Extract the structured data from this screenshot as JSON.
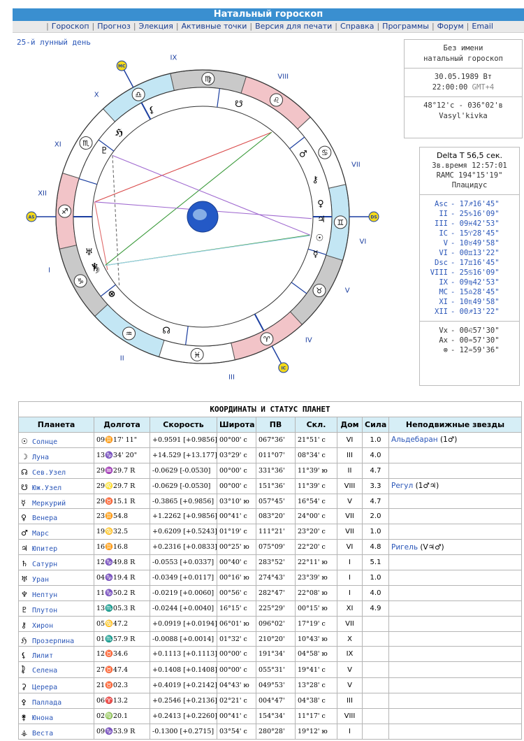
{
  "header": {
    "title": "Натальный гороскоп"
  },
  "menu": [
    "Гороскоп",
    "Прогноз",
    "Элекция",
    "Активные точки",
    "Версия для печати",
    "Справка",
    "Программы",
    "Форум",
    "Email"
  ],
  "lunar_day": "25-й лунный день",
  "info": {
    "name": "Без имени",
    "type": "натальный гороскоп",
    "date": "30.05.1989 Вт",
    "time": "22:00:00",
    "gmt": "GMT+4",
    "coords": "48°12'с - 036°02'в",
    "place": "Vasyl'kivka"
  },
  "params": {
    "delta_t": "Delta T   56,5 сек.",
    "sidereal": "Зв.время 12:57:01",
    "ramc": "RAMC 194°15'19\"",
    "system": "Плацидус",
    "houses": [
      {
        "k": "Asc",
        "v": "17♐16'45\""
      },
      {
        "k": "II",
        "v": "25♑16'09\""
      },
      {
        "k": "III",
        "v": "09♓42'53\""
      },
      {
        "k": "IC",
        "v": "15♈28'45\""
      },
      {
        "k": "V",
        "v": "10♉49'58\""
      },
      {
        "k": "VI",
        "v": "00♊13'22\""
      },
      {
        "k": "Dsc",
        "v": "17♊16'45\""
      },
      {
        "k": "VIII",
        "v": "25♋16'09\""
      },
      {
        "k": "IX",
        "v": "09♍42'53\""
      },
      {
        "k": "MC",
        "v": "15♎28'45\""
      },
      {
        "k": "XI",
        "v": "10♏49'58\""
      },
      {
        "k": "XII",
        "v": "00♐13'22\""
      }
    ],
    "points": [
      {
        "k": "Vx",
        "v": "00♌57'30\""
      },
      {
        "k": "Ax",
        "v": "00♒57'30\""
      },
      {
        "k": "⊗",
        "v": "12♒59'36\""
      }
    ]
  },
  "wheel": {
    "house_labels": [
      "I",
      "II",
      "III",
      "IV",
      "V",
      "VI",
      "VII",
      "VIII",
      "IX",
      "X",
      "XI",
      "XII"
    ],
    "angle_labels": {
      "as": "AS",
      "ds": "DS",
      "mc": "MC",
      "ic": "IC"
    },
    "signs": [
      "♈",
      "♉",
      "♊",
      "♋",
      "♌",
      "♍",
      "♎",
      "♏",
      "♐",
      "♑",
      "♒",
      "♓"
    ],
    "planet_glyphs": [
      "☉",
      "☽",
      "☊",
      "☋",
      "☿",
      "♀",
      "♂",
      "♃",
      "♄",
      "♅",
      "♆",
      "♇",
      "⚷",
      "ℌ",
      "⚸",
      "⯝",
      "⚳",
      "⚴",
      "⚵",
      "⚶",
      "⊗"
    ],
    "colors": {
      "fire": "#f2c4c8",
      "earth": "#c9c9c9",
      "air": "#c3e6f4",
      "water": "#ffffff",
      "accent": "#2a56b8",
      "mark": "#f3d91a"
    }
  },
  "table": {
    "caption": "КООРДИНАТЫ И СТАТУС ПЛАНЕТ",
    "headers": [
      "Планета",
      "Долгота",
      "Скорость",
      "Широта",
      "ПВ",
      "Скл.",
      "Дом",
      "Сила",
      "Неподвижные звезды"
    ],
    "rows": [
      {
        "sym": "☉",
        "name": "Солнце",
        "lon": "09♊17' 11\"",
        "spd": "+0.9591  [+0.9856]",
        "lat": "00°00' с",
        "pv": "067°36'",
        "dec": "21°51' с",
        "house": "VI",
        "power": "1.0",
        "star": "Альдебаран",
        "star_det": "(1♂)"
      },
      {
        "sym": "☽",
        "name": "Луна",
        "lon": "13♑34' 20\"",
        "spd": "+14.529  [+13.177]",
        "lat": "03°29' с",
        "pv": "011°07'",
        "dec": "08°34' с",
        "house": "III",
        "power": "4.0",
        "star": "",
        "star_det": ""
      },
      {
        "sym": "☊",
        "name": "Сев.Узел",
        "lon": "29♒29.7  R",
        "spd": "-0.0629  [-0.0530]",
        "lat": "00°00' с",
        "pv": "331°36'",
        "dec": "11°39' ю",
        "house": "II",
        "power": "4.7",
        "star": "",
        "star_det": ""
      },
      {
        "sym": "☋",
        "name": "Юж.Узел",
        "lon": "29♌29.7  R",
        "spd": "-0.0629  [-0.0530]",
        "lat": "00°00' с",
        "pv": "151°36'",
        "dec": "11°39' с",
        "house": "VIII",
        "power": "3.3",
        "star": "Регул",
        "star_det": "(1♂♃)"
      },
      {
        "sym": "☿",
        "name": "Меркурий",
        "lon": "29♉15.1  R",
        "spd": "-0.3865  [+0.9856]",
        "lat": "03°10' ю",
        "pv": "057°45'",
        "dec": "16°54' с",
        "house": "V",
        "power": "4.7",
        "star": "",
        "star_det": ""
      },
      {
        "sym": "♀",
        "name": "Венера",
        "lon": "23♊54.8",
        "spd": "+1.2262  [+0.9856]",
        "lat": "00°41' с",
        "pv": "083°20'",
        "dec": "24°00' с",
        "house": "VII",
        "power": "2.0",
        "star": "",
        "star_det": ""
      },
      {
        "sym": "♂",
        "name": "Марс",
        "lon": "19♋32.5",
        "spd": "+0.6209  [+0.5243]",
        "lat": "01°19' с",
        "pv": "111°21'",
        "dec": "23°20' с",
        "house": "VII",
        "power": "1.0",
        "star": "",
        "star_det": ""
      },
      {
        "sym": "♃",
        "name": "Юпитер",
        "lon": "16♊16.8",
        "spd": "+0.2316  [+0.0833]",
        "lat": "00°25' ю",
        "pv": "075°09'",
        "dec": "22°20' с",
        "house": "VI",
        "power": "4.8",
        "star": "Ригель",
        "star_det": "(V♃♂)"
      },
      {
        "sym": "♄",
        "name": "Сатурн",
        "lon": "12♑49.8  R",
        "spd": "-0.0553  [+0.0337]",
        "lat": "00°40' с",
        "pv": "283°52'",
        "dec": "22°11' ю",
        "house": "I",
        "power": "5.1",
        "star": "",
        "star_det": ""
      },
      {
        "sym": "♅",
        "name": "Уран",
        "lon": "04♑19.4  R",
        "spd": "-0.0349  [+0.0117]",
        "lat": "00°16' ю",
        "pv": "274°43'",
        "dec": "23°39' ю",
        "house": "I",
        "power": "1.0",
        "star": "",
        "star_det": ""
      },
      {
        "sym": "♆",
        "name": "Нептун",
        "lon": "11♑50.2  R",
        "spd": "-0.0219  [+0.0060]",
        "lat": "00°56' с",
        "pv": "282°47'",
        "dec": "22°08' ю",
        "house": "I",
        "power": "4.0",
        "star": "",
        "star_det": ""
      },
      {
        "sym": "♇",
        "name": "Плутон",
        "lon": "13♏05.3  R",
        "spd": "-0.0244  [+0.0040]",
        "lat": "16°15' с",
        "pv": "225°29'",
        "dec": "00°15' ю",
        "house": "XI",
        "power": "4.9",
        "star": "",
        "star_det": ""
      },
      {
        "sym": "⚷",
        "name": "Хирон",
        "lon": "05♋47.2",
        "spd": "+0.0919  [+0.0194]",
        "lat": "06°01' ю",
        "pv": "096°02'",
        "dec": "17°19' с",
        "house": "VII",
        "power": "",
        "star": "",
        "star_det": ""
      },
      {
        "sym": "ℌ",
        "name": "Прозерпина",
        "lon": "01♏57.9  R",
        "spd": "-0.0088  [+0.0014]",
        "lat": "01°32' с",
        "pv": "210°20'",
        "dec": "10°43' ю",
        "house": "X",
        "power": "",
        "star": "",
        "star_det": ""
      },
      {
        "sym": "⚸",
        "name": "Лилит",
        "lon": "12♉34.6",
        "spd": "+0.1113  [+0.1113]",
        "lat": "00°00' с",
        "pv": "191°34'",
        "dec": "04°58' ю",
        "house": "IX",
        "power": "",
        "star": "",
        "star_det": ""
      },
      {
        "sym": "⯝",
        "name": "Селена",
        "lon": "27♉47.4",
        "spd": "+0.1408  [+0.1408]",
        "lat": "00°00' с",
        "pv": "055°31'",
        "dec": "19°41' с",
        "house": "V",
        "power": "",
        "star": "",
        "star_det": ""
      },
      {
        "sym": "⚳",
        "name": "Церера",
        "lon": "21♉02.3",
        "spd": "+0.4019  [+0.2142]",
        "lat": "04°43' ю",
        "pv": "049°53'",
        "dec": "13°28' с",
        "house": "V",
        "power": "",
        "star": "",
        "star_det": ""
      },
      {
        "sym": "⚴",
        "name": "Паллада",
        "lon": "06♈13.2",
        "spd": "+0.2546  [+0.2136]",
        "lat": "02°21' с",
        "pv": "004°47'",
        "dec": "04°38' с",
        "house": "III",
        "power": "",
        "star": "",
        "star_det": ""
      },
      {
        "sym": "⚵",
        "name": "Юнона",
        "lon": "02♍20.1",
        "spd": "+0.2413  [+0.2260]",
        "lat": "00°41' с",
        "pv": "154°34'",
        "dec": "11°17' с",
        "house": "VIII",
        "power": "",
        "star": "",
        "star_det": ""
      },
      {
        "sym": "⚶",
        "name": "Веста",
        "lon": "09♑53.9  R",
        "spd": "-0.1300  [+0.2715]",
        "lat": "03°54' с",
        "pv": "280°28'",
        "dec": "19°12' ю",
        "house": "I",
        "power": "",
        "star": "",
        "star_det": ""
      }
    ]
  }
}
